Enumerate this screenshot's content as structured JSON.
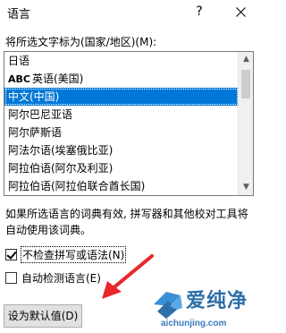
{
  "window": {
    "title": "语言",
    "help_label": "?",
    "close_icon": "close-icon"
  },
  "prompt": "将所选文字标为(国家/地区)(M):",
  "languages": [
    {
      "label": "日语",
      "selected": false,
      "spell_icon": false
    },
    {
      "label": "英语(美国)",
      "selected": false,
      "spell_icon": true
    },
    {
      "label": "中文(中国)",
      "selected": true,
      "spell_icon": false
    },
    {
      "label": "阿尔巴尼亚语",
      "selected": false,
      "spell_icon": false
    },
    {
      "label": "阿尔萨斯语",
      "selected": false,
      "spell_icon": false
    },
    {
      "label": "阿法尔语(埃塞俄比亚)",
      "selected": false,
      "spell_icon": false
    },
    {
      "label": "阿拉伯语(阿尔及利亚)",
      "selected": false,
      "spell_icon": false
    },
    {
      "label": "阿拉伯语(阿拉伯联合酋长国)",
      "selected": false,
      "spell_icon": false
    }
  ],
  "spell_icon_text": "ABC",
  "note": "如果所选语言的词典有效, 拼写器和其他校对工具将自动使用该词典。",
  "options": {
    "no_spellcheck": {
      "label": "不检查拼写或语法(N)",
      "checked": true
    },
    "auto_detect": {
      "label": "自动检测语言(E)",
      "checked": false
    }
  },
  "default_button": "设为默认值(D)",
  "watermark": {
    "text": "爱纯净",
    "url": "aichunjing.com"
  },
  "colors": {
    "selection": "#0078d7",
    "arrow": "#e8262b",
    "watermark": "#2d6fa8"
  }
}
